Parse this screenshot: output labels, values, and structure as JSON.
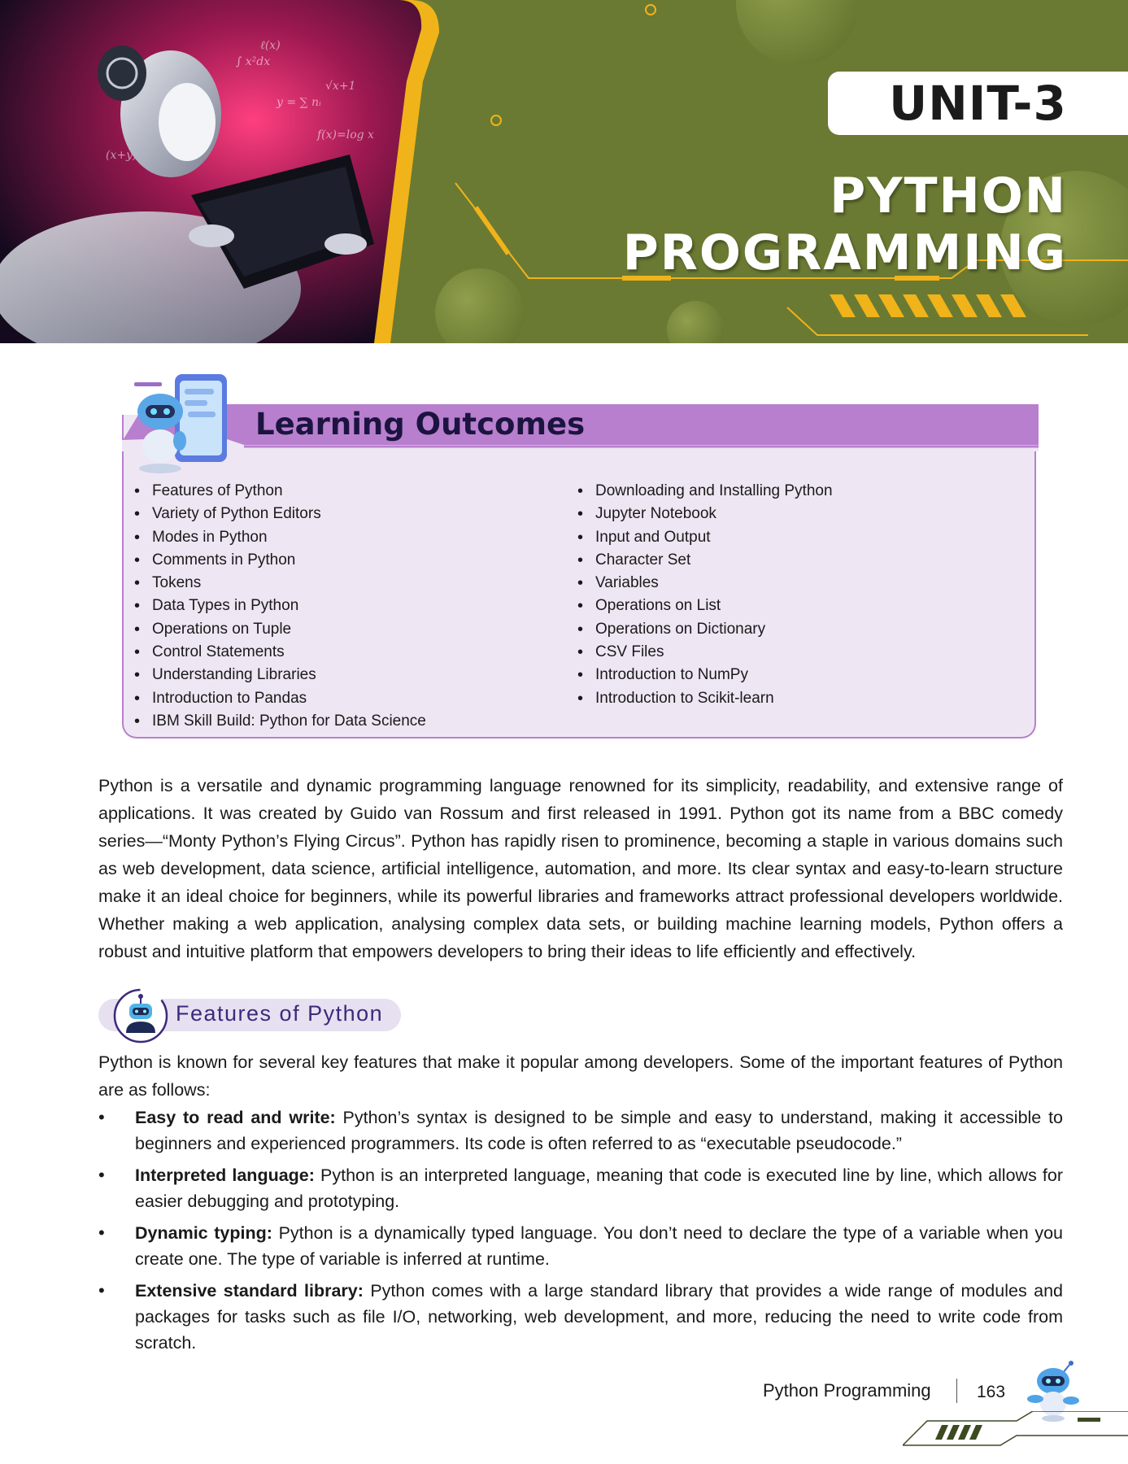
{
  "banner": {
    "unit_label": "UNIT-3",
    "title": "PYTHON PROGRAMMING"
  },
  "learning_outcomes": {
    "title": "Learning Outcomes",
    "left_items": [
      "Features of Python",
      "Variety of Python Editors",
      "Modes in Python",
      "Comments in Python",
      "Tokens",
      "Data Types in Python",
      "Operations on Tuple",
      "Control Statements",
      "Understanding Libraries",
      "Introduction to Pandas",
      "IBM Skill Build: Python for Data Science"
    ],
    "right_items": [
      "Downloading and Installing Python",
      "Jupyter Notebook",
      "Input and Output",
      "Character Set",
      "Variables",
      "Operations on List",
      "Operations on Dictionary",
      "CSV Files",
      "Introduction to NumPy",
      "Introduction to Scikit-learn"
    ]
  },
  "intro_paragraph": "Python is a versatile and dynamic programming language renowned for its simplicity, readability, and extensive range of applications. It was created by Guido van Rossum and first released in 1991. Python got its name from a BBC comedy series—“Monty Python’s Flying Circus”. Python has rapidly risen to prominence, becoming a staple in various domains such as web development, data science, artificial intelligence, automation, and more. Its clear syntax and easy-to-learn structure make it an ideal choice for beginners, while its powerful libraries and frameworks attract professional developers worldwide. Whether making a web application, analysing complex data sets, or building machine learning models, Python offers a robust and intuitive platform that empowers developers to bring their ideas to life efficiently and effectively.",
  "features_section": {
    "heading": "Features of Python",
    "intro": "Python is known for several key features that make it popular among developers. Some of the important features of Python are as follows:",
    "bullets": [
      {
        "term": "Easy to read and write:",
        "text": " Python’s syntax is designed to be simple and easy to understand, making it accessible to beginners and experienced programmers. Its code is often referred to as “executable pseudocode.”"
      },
      {
        "term": "Interpreted language:",
        "text": " Python is an interpreted language, meaning that code is executed line by line, which allows for easier debugging and prototyping."
      },
      {
        "term": "Dynamic typing:",
        "text": " Python is a dynamically typed language. You don’t need to declare the type of a variable when you create one. The type of variable is inferred at runtime."
      },
      {
        "term": "Extensive standard library:",
        "text": " Python comes with a large standard library that provides a wide range of modules and packages for tasks such as file I/O, networking, web development, and more, reducing the need to write code from scratch."
      }
    ]
  },
  "footer": {
    "book_title": "Python Programming",
    "page_number": "163"
  },
  "colors": {
    "banner_green": "#6a7a32",
    "accent_yellow": "#f0b31a",
    "outcomes_purple": "#b87fce",
    "outcomes_bg": "#efe6f4",
    "heading_purple": "#3c2a7a"
  }
}
